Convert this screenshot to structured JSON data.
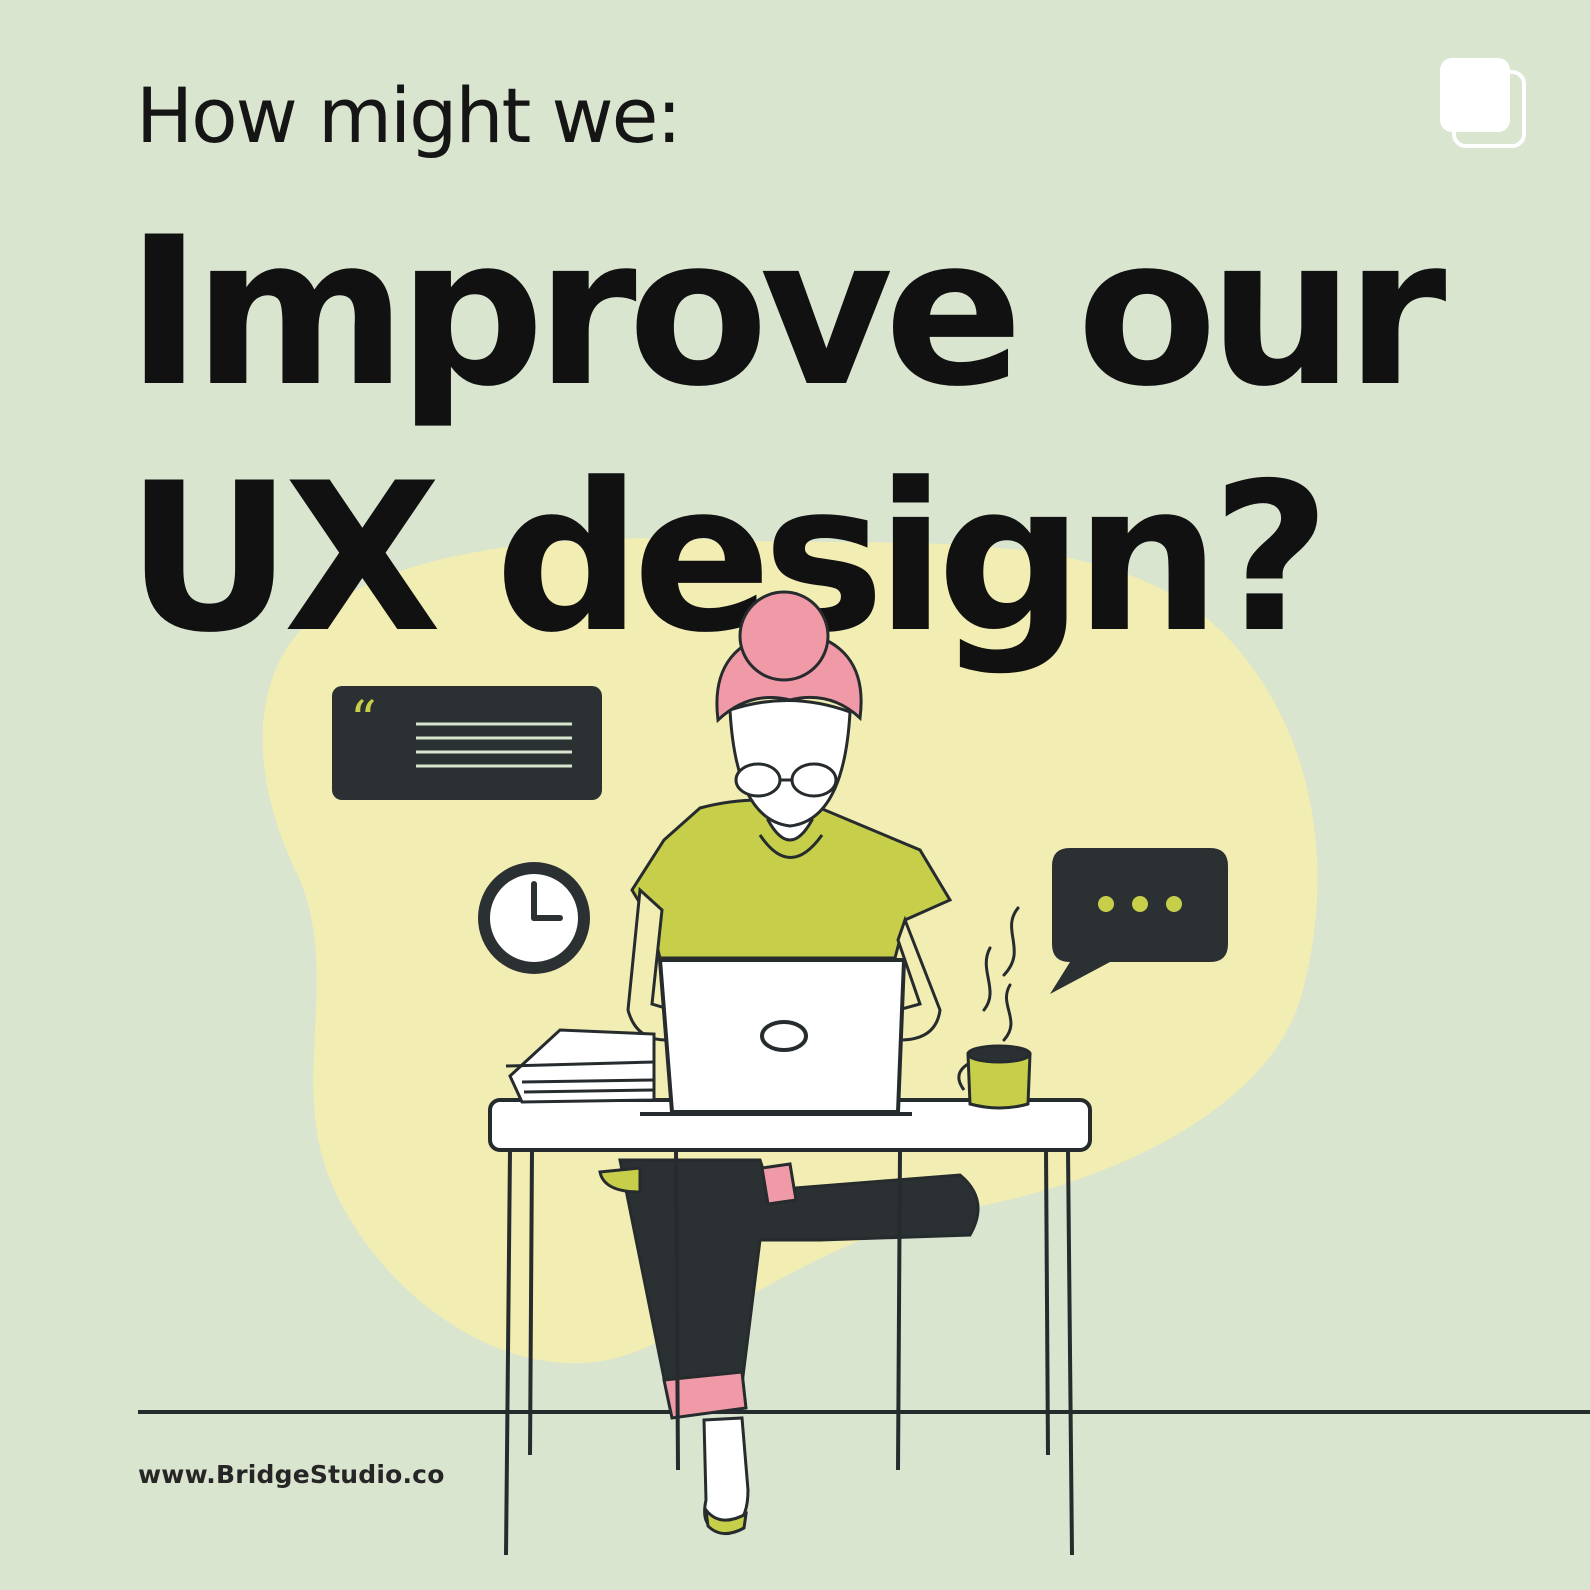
{
  "post": {
    "kicker": "How might we:",
    "headline_line1": "Improve our",
    "headline_line2": "UX design?",
    "footer_url": "www.BridgeStudio.co",
    "multi_post_icon": "carousel-stack-icon"
  },
  "colors": {
    "background": "#d9e5cf",
    "blob": "#f1edb3",
    "accent_yellow": "#c7cf4a",
    "hair_pink": "#ef9aa6",
    "ink": "#262b2e",
    "white": "#ffffff"
  },
  "illustration": {
    "quote_card_icon": "quote-icon",
    "clock_icon": "clock-icon",
    "chat_icon": "chat-bubble-icon",
    "laptop_icon": "laptop-icon",
    "mug_icon": "coffee-mug-icon",
    "books_icon": "books-icon"
  }
}
